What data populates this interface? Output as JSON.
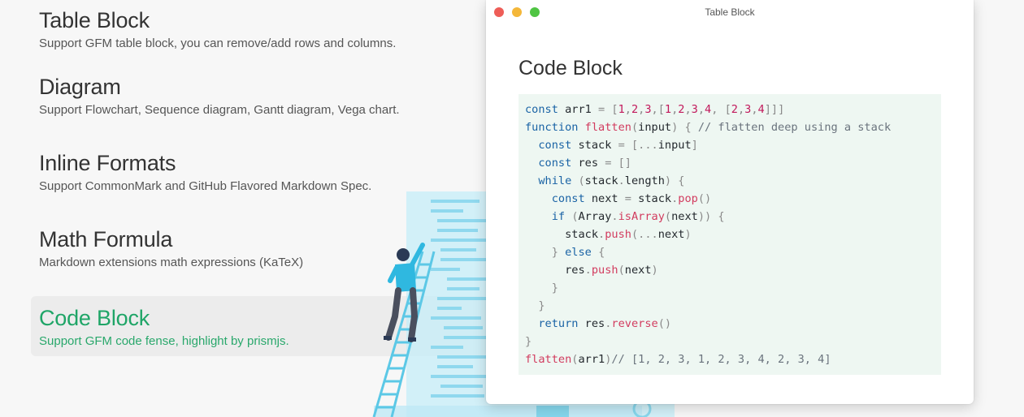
{
  "features": [
    {
      "title": "Table Block",
      "desc": "Support GFM table block, you can remove/add rows and columns.",
      "active": false
    },
    {
      "title": "Diagram",
      "desc": "Support Flowchart, Sequence diagram, Gantt diagram, Vega chart.",
      "active": false
    },
    {
      "title": "Inline Formats",
      "desc": "Support CommonMark and GitHub Flavored Markdown Spec.",
      "active": false
    },
    {
      "title": "Math Formula",
      "desc": "Markdown extensions math expressions (KaTeX)",
      "active": false
    },
    {
      "title": "Code Block",
      "desc": "Support GFM code fense, highlight by prismjs.",
      "active": true
    }
  ],
  "window": {
    "title": "Table Block",
    "heading": "Code Block"
  },
  "colors": {
    "accent": "#1fa567",
    "code_background": "#eef7f2",
    "keyword": "#1a63a5",
    "function": "#d23c5f",
    "number": "#c2185b",
    "comment": "#6a737d",
    "punctuation": "#8a8a8a"
  },
  "code_lines": [
    [
      [
        "keyword",
        "const"
      ],
      [
        "plain",
        " arr1 "
      ],
      [
        "punct",
        "="
      ],
      [
        "plain",
        " "
      ],
      [
        "punct",
        "["
      ],
      [
        "number",
        "1"
      ],
      [
        "punct",
        ","
      ],
      [
        "number",
        "2"
      ],
      [
        "punct",
        ","
      ],
      [
        "number",
        "3"
      ],
      [
        "punct",
        ","
      ],
      [
        "punct",
        "["
      ],
      [
        "number",
        "1"
      ],
      [
        "punct",
        ","
      ],
      [
        "number",
        "2"
      ],
      [
        "punct",
        ","
      ],
      [
        "number",
        "3"
      ],
      [
        "punct",
        ","
      ],
      [
        "number",
        "4"
      ],
      [
        "punct",
        ","
      ],
      [
        "plain",
        " "
      ],
      [
        "punct",
        "["
      ],
      [
        "number",
        "2"
      ],
      [
        "punct",
        ","
      ],
      [
        "number",
        "3"
      ],
      [
        "punct",
        ","
      ],
      [
        "number",
        "4"
      ],
      [
        "punct",
        "]]]"
      ]
    ],
    [
      [
        "keyword",
        "function"
      ],
      [
        "plain",
        " "
      ],
      [
        "function",
        "flatten"
      ],
      [
        "punct",
        "("
      ],
      [
        "plain",
        "input"
      ],
      [
        "punct",
        ")"
      ],
      [
        "plain",
        " "
      ],
      [
        "punct",
        "{"
      ],
      [
        "plain",
        " "
      ],
      [
        "comment",
        "// flatten deep using a stack"
      ]
    ],
    [
      [
        "plain",
        "  "
      ],
      [
        "keyword",
        "const"
      ],
      [
        "plain",
        " stack "
      ],
      [
        "punct",
        "="
      ],
      [
        "plain",
        " "
      ],
      [
        "punct",
        "["
      ],
      [
        "punct",
        "..."
      ],
      [
        "plain",
        "input"
      ],
      [
        "punct",
        "]"
      ]
    ],
    [
      [
        "plain",
        "  "
      ],
      [
        "keyword",
        "const"
      ],
      [
        "plain",
        " res "
      ],
      [
        "punct",
        "="
      ],
      [
        "plain",
        " "
      ],
      [
        "punct",
        "[]"
      ]
    ],
    [
      [
        "plain",
        "  "
      ],
      [
        "keyword",
        "while"
      ],
      [
        "plain",
        " "
      ],
      [
        "punct",
        "("
      ],
      [
        "plain",
        "stack"
      ],
      [
        "punct",
        "."
      ],
      [
        "plain",
        "length"
      ],
      [
        "punct",
        ")"
      ],
      [
        "plain",
        " "
      ],
      [
        "punct",
        "{"
      ]
    ],
    [
      [
        "plain",
        "    "
      ],
      [
        "keyword",
        "const"
      ],
      [
        "plain",
        " next "
      ],
      [
        "punct",
        "="
      ],
      [
        "plain",
        " stack"
      ],
      [
        "punct",
        "."
      ],
      [
        "function",
        "pop"
      ],
      [
        "punct",
        "()"
      ]
    ],
    [
      [
        "plain",
        "    "
      ],
      [
        "keyword",
        "if"
      ],
      [
        "plain",
        " "
      ],
      [
        "punct",
        "("
      ],
      [
        "plain",
        "Array"
      ],
      [
        "punct",
        "."
      ],
      [
        "function",
        "isArray"
      ],
      [
        "punct",
        "("
      ],
      [
        "plain",
        "next"
      ],
      [
        "punct",
        "))"
      ],
      [
        "plain",
        " "
      ],
      [
        "punct",
        "{"
      ]
    ],
    [
      [
        "plain",
        "      stack"
      ],
      [
        "punct",
        "."
      ],
      [
        "function",
        "push"
      ],
      [
        "punct",
        "("
      ],
      [
        "punct",
        "..."
      ],
      [
        "plain",
        "next"
      ],
      [
        "punct",
        ")"
      ]
    ],
    [
      [
        "plain",
        "    "
      ],
      [
        "punct",
        "}"
      ],
      [
        "plain",
        " "
      ],
      [
        "keyword",
        "else"
      ],
      [
        "plain",
        " "
      ],
      [
        "punct",
        "{"
      ]
    ],
    [
      [
        "plain",
        "      res"
      ],
      [
        "punct",
        "."
      ],
      [
        "function",
        "push"
      ],
      [
        "punct",
        "("
      ],
      [
        "plain",
        "next"
      ],
      [
        "punct",
        ")"
      ]
    ],
    [
      [
        "plain",
        "    "
      ],
      [
        "punct",
        "}"
      ]
    ],
    [
      [
        "plain",
        "  "
      ],
      [
        "punct",
        "}"
      ]
    ],
    [
      [
        "plain",
        "  "
      ],
      [
        "keyword",
        "return"
      ],
      [
        "plain",
        " res"
      ],
      [
        "punct",
        "."
      ],
      [
        "function",
        "reverse"
      ],
      [
        "punct",
        "()"
      ]
    ],
    [
      [
        "punct",
        "}"
      ]
    ],
    [
      [
        "function",
        "flatten"
      ],
      [
        "punct",
        "("
      ],
      [
        "plain",
        "arr1"
      ],
      [
        "punct",
        ")"
      ],
      [
        "comment",
        "// [1, 2, 3, 1, 2, 3, 4, 2, 3, 4]"
      ]
    ]
  ]
}
